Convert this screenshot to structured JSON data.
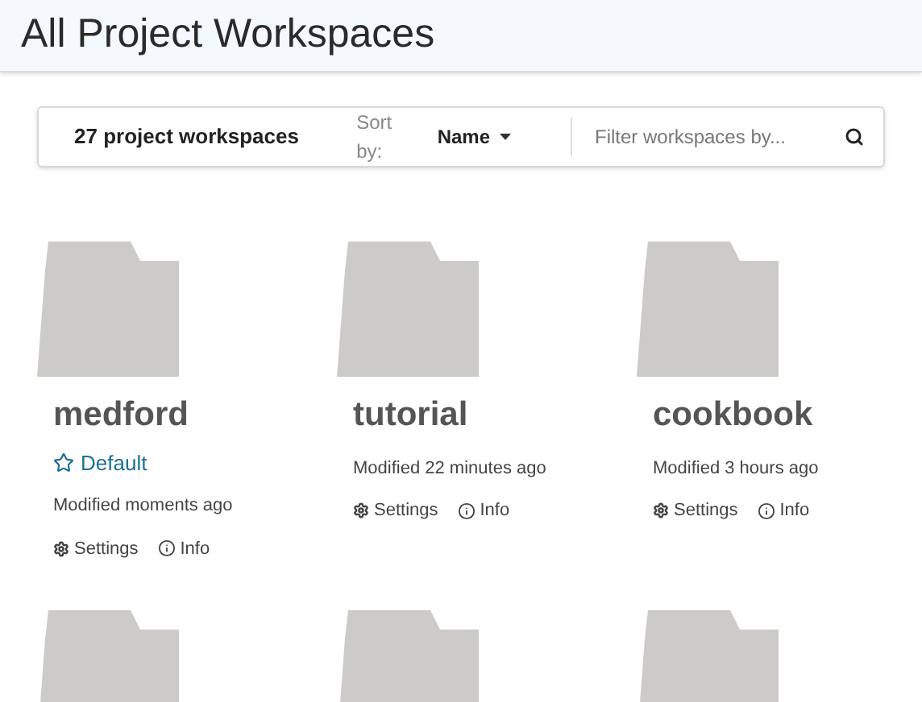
{
  "header": {
    "title": "All Project Workspaces"
  },
  "toolbar": {
    "count": "27 project workspaces",
    "sort_label": "Sort by:",
    "sort_value": "Name",
    "filter": {
      "placeholder": "Filter workspaces by..."
    }
  },
  "workspaces": [
    {
      "name": "medford",
      "badge": "Default",
      "modified": "Modified moments ago",
      "actions": [
        "Settings",
        "Info"
      ]
    },
    {
      "name": "tutorial",
      "modified": "Modified 22 minutes ago",
      "actions": [
        "Settings",
        "Info"
      ]
    },
    {
      "name": "cookbook",
      "modified": "Modified 3 hours ago",
      "actions": [
        "Settings",
        "Info"
      ]
    }
  ]
}
